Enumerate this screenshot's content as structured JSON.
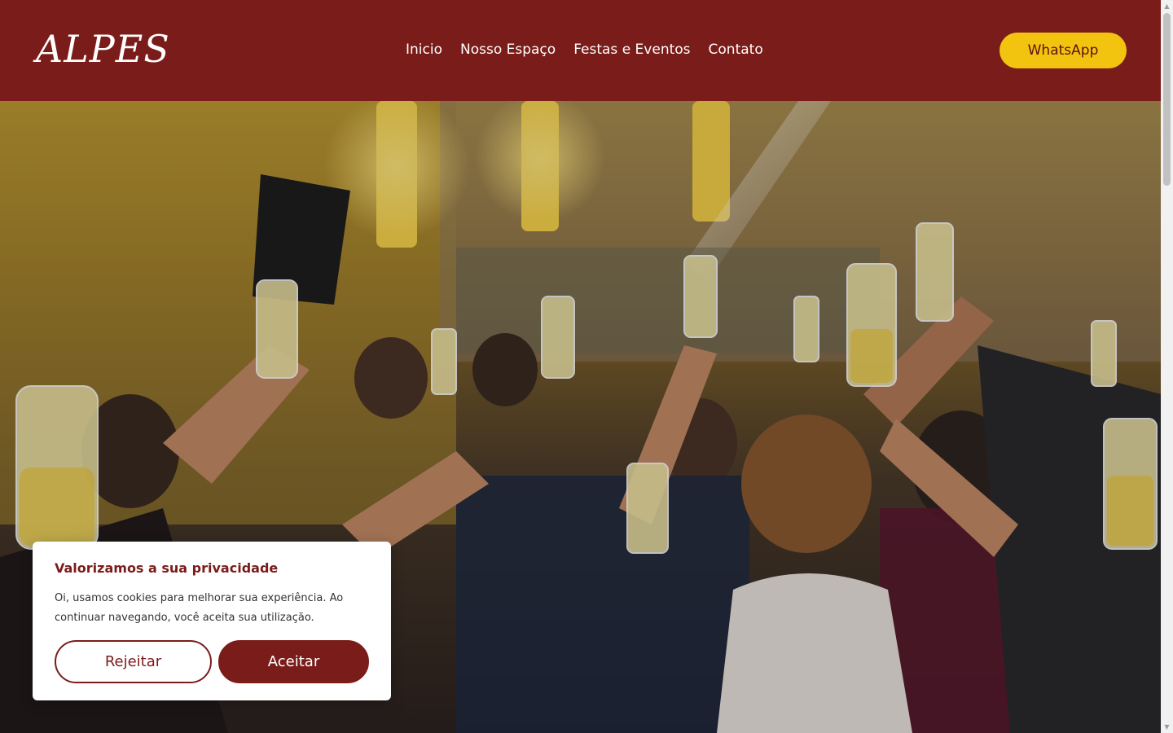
{
  "brand": {
    "logo_text": "ALPES"
  },
  "nav": {
    "items": [
      {
        "label": "Inicio"
      },
      {
        "label": "Nosso Espaço"
      },
      {
        "label": "Festas e Eventos"
      },
      {
        "label": "Contato"
      }
    ]
  },
  "header": {
    "cta_label": "WhatsApp"
  },
  "hero": {
    "image_icon": "celebration-toast-photo"
  },
  "cookie_banner": {
    "title": "Valorizamos a sua privacidade",
    "text": "Oi, usamos cookies para melhorar sua experiência. Ao continuar navegando, você aceita sua utilização.",
    "reject_label": "Rejeitar",
    "accept_label": "Aceitar"
  },
  "colors": {
    "brand_red": "#7a1c1a",
    "cta_yellow": "#f2c40f",
    "white": "#ffffff"
  }
}
